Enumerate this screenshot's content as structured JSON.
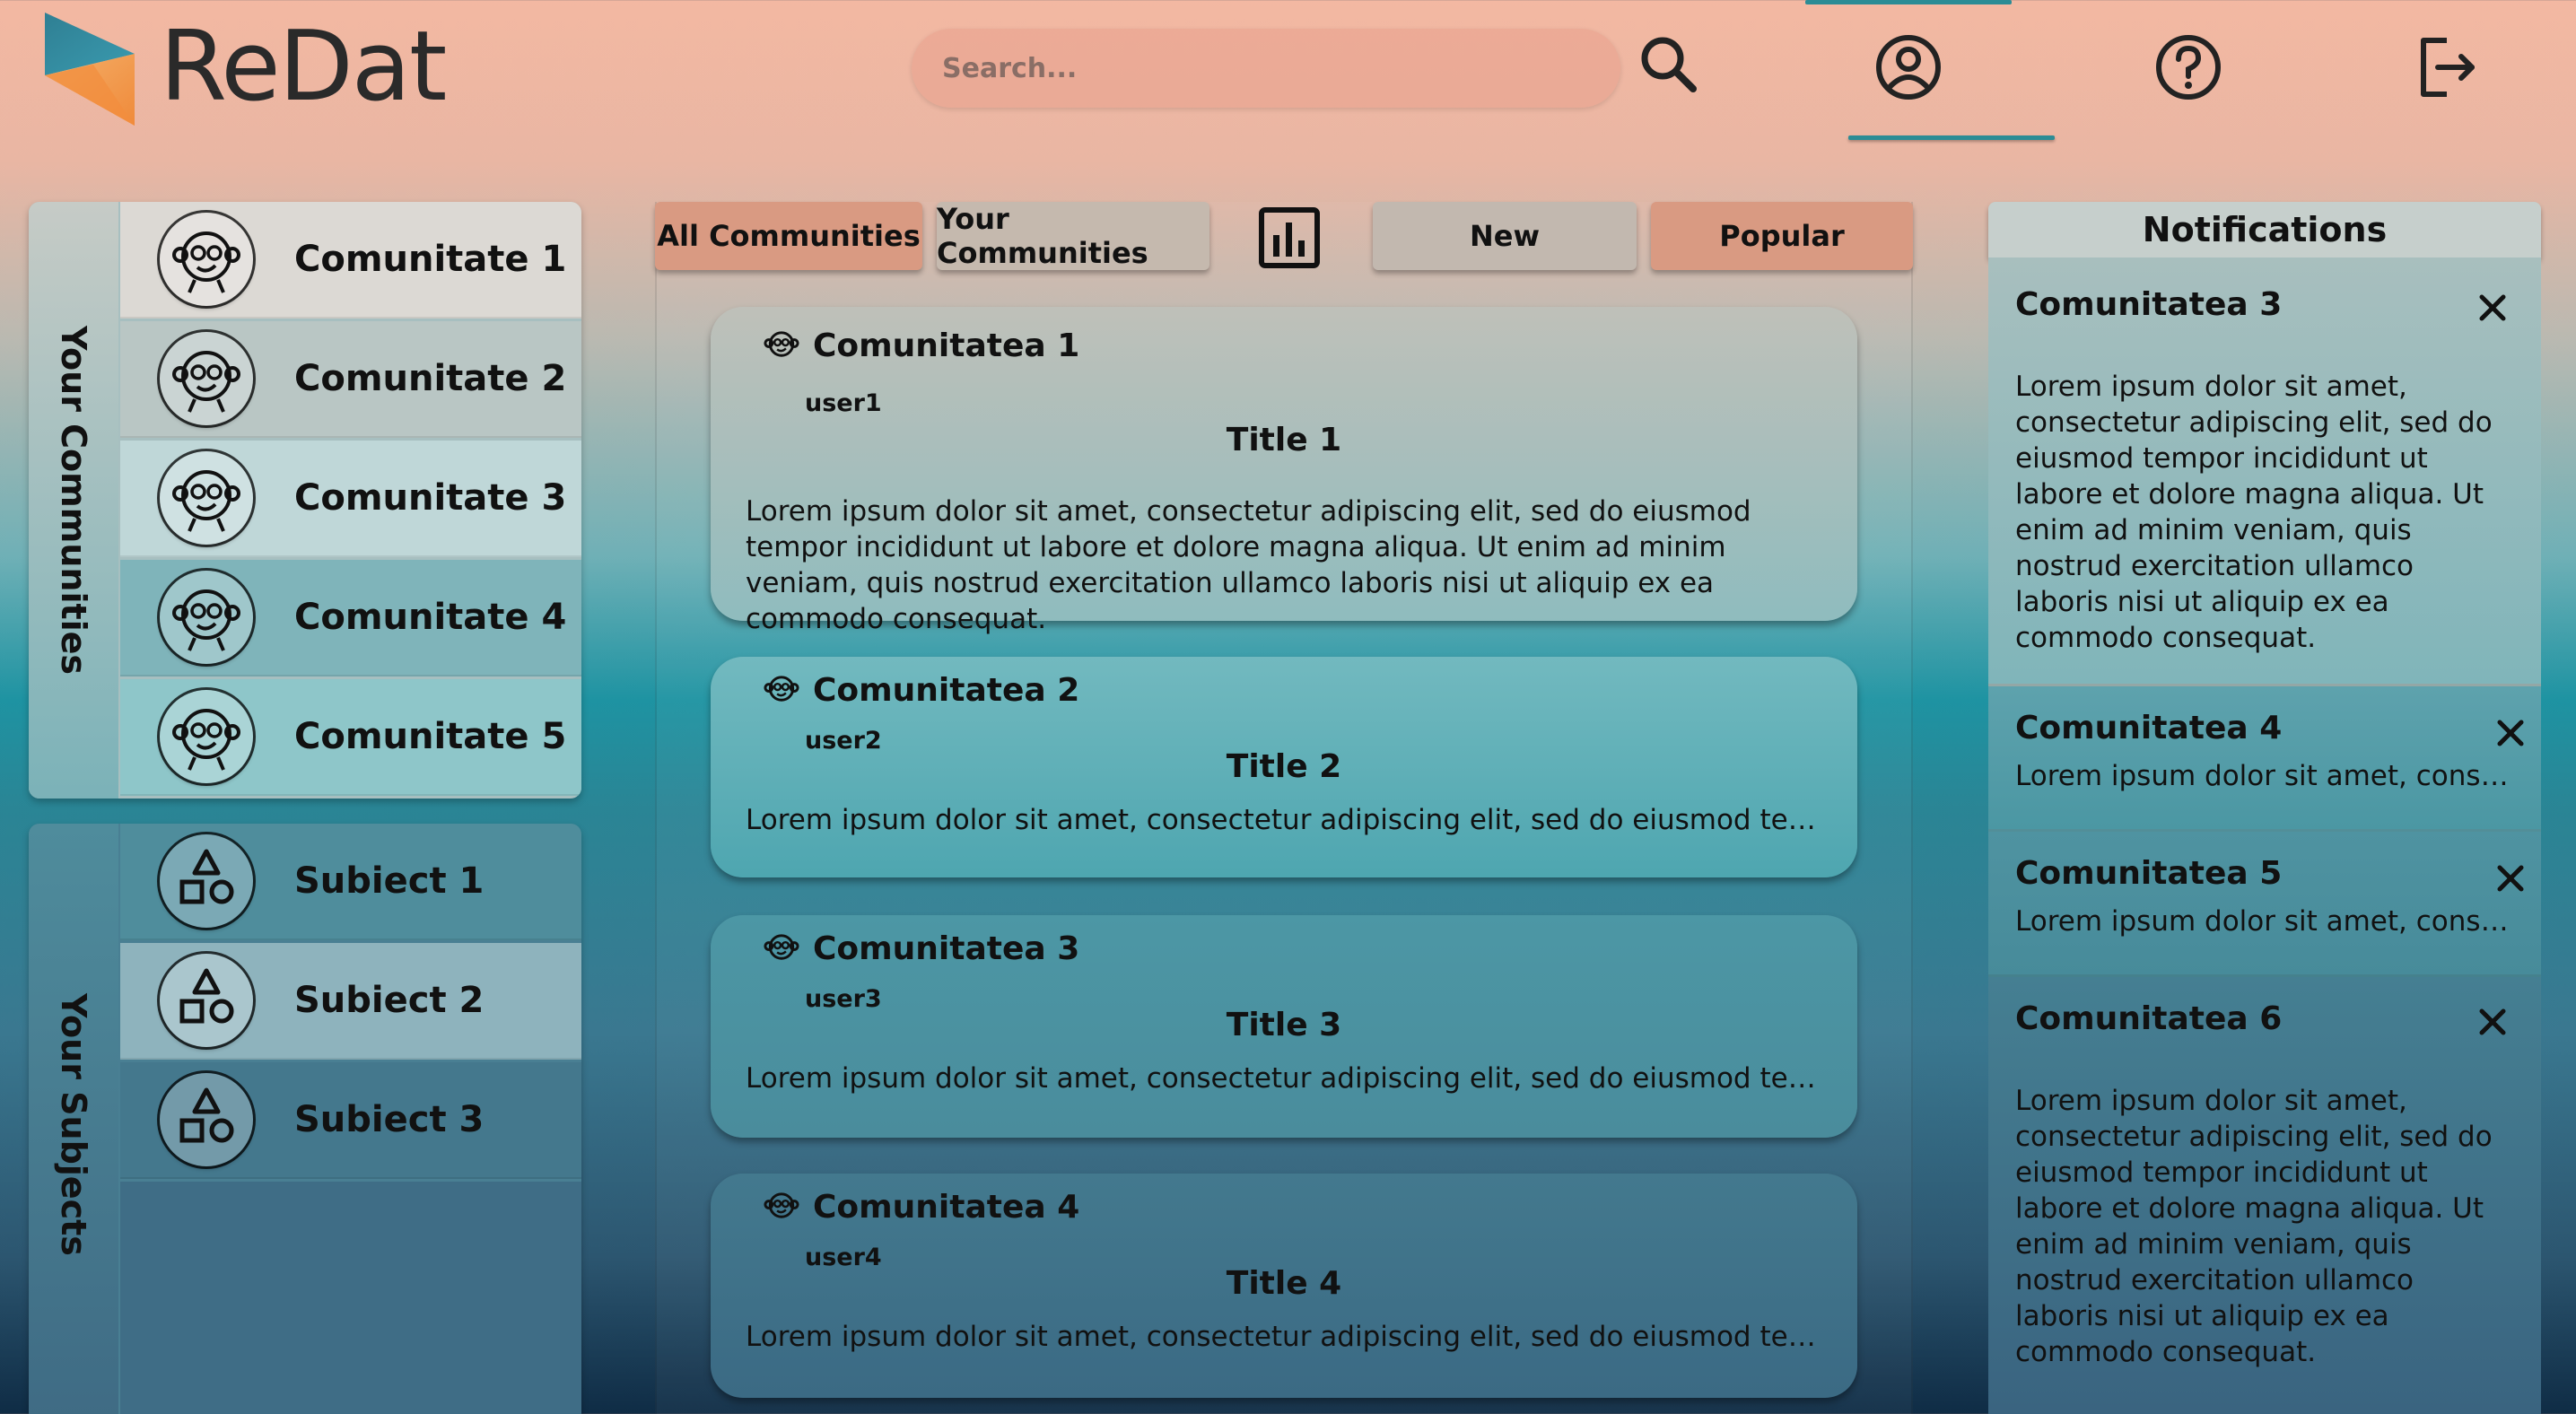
{
  "header": {
    "app_name": "ReDat",
    "search_placeholder": "Search...",
    "icons": [
      "search-icon",
      "profile-icon",
      "help-icon",
      "logout-icon"
    ]
  },
  "sidebar": {
    "communities_label": "Your Communities",
    "communities": [
      {
        "label": "Comunitate 1"
      },
      {
        "label": "Comunitate 2"
      },
      {
        "label": "Comunitate 3"
      },
      {
        "label": "Comunitate 4"
      },
      {
        "label": "Comunitate 5"
      }
    ],
    "subjects_label": "Your Subjects",
    "subjects": [
      {
        "label": "Subiect 1"
      },
      {
        "label": "Subiect 2"
      },
      {
        "label": "Subiect 3"
      }
    ]
  },
  "feed": {
    "tabs": {
      "all": "All Communities",
      "yours": "Your Communities",
      "new": "New",
      "popular": "Popular"
    },
    "posts": [
      {
        "community": "Comunitatea 1",
        "user": "user1",
        "title": "Title 1",
        "body": "Lorem ipsum dolor sit amet, consectetur adipiscing elit, sed do eiusmod tempor incididunt ut labore et dolore magna aliqua. Ut enim ad minim veniam, quis nostrud exercitation ullamco laboris nisi ut aliquip ex ea commodo consequat."
      },
      {
        "community": "Comunitatea 2",
        "user": "user2",
        "title": "Title 2",
        "body": "Lorem ipsum dolor sit amet, consectetur adipiscing elit, sed do eiusmod tempor in..."
      },
      {
        "community": "Comunitatea 3",
        "user": "user3",
        "title": "Title 3",
        "body": "Lorem ipsum dolor sit amet, consectetur adipiscing elit, sed do eiusmod tempor in..."
      },
      {
        "community": "Comunitatea 4",
        "user": "user4",
        "title": "Title 4",
        "body": "Lorem ipsum dolor sit amet, consectetur adipiscing elit, sed do eiusmod tempor in..."
      }
    ]
  },
  "notifications": {
    "title": "Notifications",
    "items": [
      {
        "title": "Comunitatea 3",
        "text": "Lorem ipsum dolor sit amet, consectetur adipiscing elit, sed do eiusmod tempor incididunt ut labore et dolore magna aliqua. Ut enim ad minim veniam, quis nostrud exercitation ullamco laboris nisi ut aliquip ex ea commodo consequat."
      },
      {
        "title": "Comunitatea 4",
        "text": "Lorem ipsum dolor sit amet, conse..."
      },
      {
        "title": "Comunitatea 5",
        "text": "Lorem ipsum dolor sit amet, conse..."
      },
      {
        "title": "Comunitatea 6",
        "text": "Lorem ipsum dolor sit amet, consectetur adipiscing elit, sed do eiusmod tempor incididunt ut labore et dolore magna aliqua. Ut enim ad minim veniam, quis nostrud exercitation ullamco laboris nisi ut aliquip ex ea commodo consequat."
      }
    ]
  },
  "colors": {
    "accent_tab": "#d99a82",
    "neutral_tab": "#c2b8af",
    "profile_underline": "#2b8c95"
  }
}
